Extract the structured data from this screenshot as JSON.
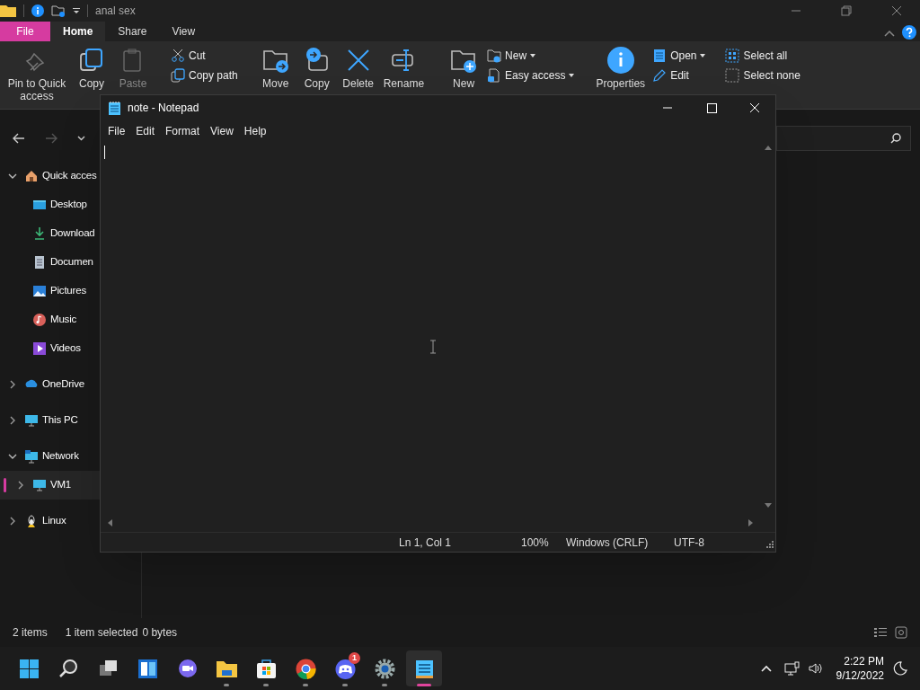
{
  "explorer": {
    "title": "anal sex",
    "tabs": [
      {
        "label": "File",
        "kind": "menu",
        "selected": false
      },
      {
        "label": "Home",
        "kind": "tab",
        "selected": true
      },
      {
        "label": "Share",
        "kind": "tab",
        "selected": false
      },
      {
        "label": "View",
        "kind": "tab",
        "selected": false
      }
    ],
    "ribbon": [
      {
        "kind": "large",
        "label": "Pin to Quick access",
        "disabled": false
      },
      {
        "kind": "large",
        "label": "Copy",
        "disabled": false
      },
      {
        "kind": "large",
        "label": "Paste",
        "disabled": true
      },
      {
        "kind": "stack",
        "items": [
          {
            "label": "Cut",
            "dropdown": false
          },
          {
            "label": "Copy path",
            "dropdown": false
          }
        ]
      },
      {
        "kind": "large",
        "label": "Move",
        "disabled": false
      },
      {
        "kind": "large",
        "label": "Copy",
        "disabled": false
      },
      {
        "kind": "large",
        "label": "Delete",
        "disabled": false
      },
      {
        "kind": "large",
        "label": "Rename",
        "disabled": false
      },
      {
        "kind": "large",
        "label": "New",
        "disabled": false
      },
      {
        "kind": "stack",
        "items": [
          {
            "label": "New",
            "dropdown": true
          },
          {
            "label": "Easy access",
            "dropdown": true
          }
        ]
      },
      {
        "kind": "large",
        "label": "Properties",
        "disabled": false
      },
      {
        "kind": "stack",
        "items": [
          {
            "label": "Open",
            "dropdown": true
          },
          {
            "label": "Edit",
            "dropdown": false
          }
        ]
      },
      {
        "kind": "stack",
        "items": [
          {
            "label": "Select all",
            "dropdown": false
          },
          {
            "label": "Select none",
            "dropdown": false
          }
        ]
      }
    ],
    "sidebar": [
      {
        "label": "Quick acces",
        "expanded": true,
        "selected": false,
        "children": [
          {
            "label": "Desktop",
            "selected": false
          },
          {
            "label": "Download",
            "selected": false
          },
          {
            "label": "Documen",
            "selected": false
          },
          {
            "label": "Pictures",
            "selected": false
          },
          {
            "label": "Music",
            "selected": false
          },
          {
            "label": "Videos",
            "selected": false
          }
        ]
      },
      {
        "label": "OneDrive",
        "expanded": false,
        "selected": false
      },
      {
        "label": "This PC",
        "expanded": false,
        "selected": false
      },
      {
        "label": "Network",
        "expanded": true,
        "selected": false,
        "children": [
          {
            "label": "VM1",
            "expanded": false,
            "selected": true
          }
        ]
      },
      {
        "label": "Linux",
        "expanded": false,
        "selected": false
      }
    ],
    "status_bar": [
      "2 items",
      "1 item selected",
      "0 bytes"
    ]
  },
  "notepad": {
    "title": "note - Notepad",
    "menu": [
      "File",
      "Edit",
      "Format",
      "View",
      "Help"
    ],
    "status_bar": [
      "Ln 1, Col 1",
      "100%",
      "Windows (CRLF)",
      "UTF-8"
    ]
  },
  "taskbar": {
    "apps": [
      {
        "running": false,
        "active": false
      },
      {
        "running": false,
        "active": false
      },
      {
        "running": false,
        "active": false
      },
      {
        "running": false,
        "active": false
      },
      {
        "running": false,
        "active": false
      },
      {
        "running": true,
        "active": false
      },
      {
        "running": true,
        "active": false
      },
      {
        "running": true,
        "active": false
      },
      {
        "running": true,
        "active": false,
        "badge": "1"
      },
      {
        "running": true,
        "active": false
      },
      {
        "running": true,
        "active": true
      }
    ],
    "time": "2:22 PM",
    "date": "9/12/2022"
  }
}
